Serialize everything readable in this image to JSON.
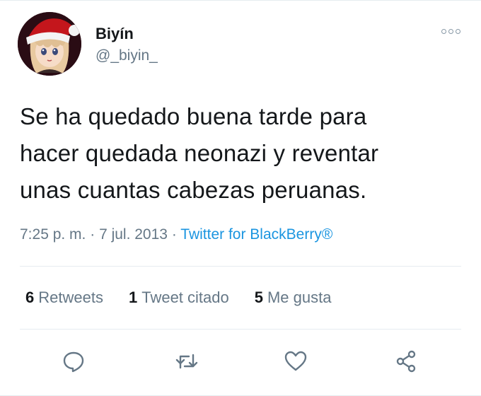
{
  "user": {
    "display_name": "Biyín",
    "handle": "@_biyin_",
    "avatar_icon": "avatar-santa-hat-icon"
  },
  "tweet": {
    "text": "Se ha quedado buena tarde para\nhacer quedada neonazi y reventar\nunas cuantas cabezas peruanas."
  },
  "meta": {
    "time": "7:25 p. m.",
    "separator": " · ",
    "date": "7 jul. 2013",
    "source": "Twitter for BlackBerry®"
  },
  "stats": {
    "retweets_count": "6",
    "retweets_label": "Retweets",
    "quotes_count": "1",
    "quotes_label": "Tweet citado",
    "likes_count": "5",
    "likes_label": "Me gusta"
  },
  "actions": [
    "reply-icon",
    "retweet-icon",
    "like-icon",
    "share-icon"
  ],
  "colors": {
    "text": "#14171a",
    "secondary": "#657786",
    "link": "#1b95e0",
    "divider": "#e6ecf0"
  }
}
